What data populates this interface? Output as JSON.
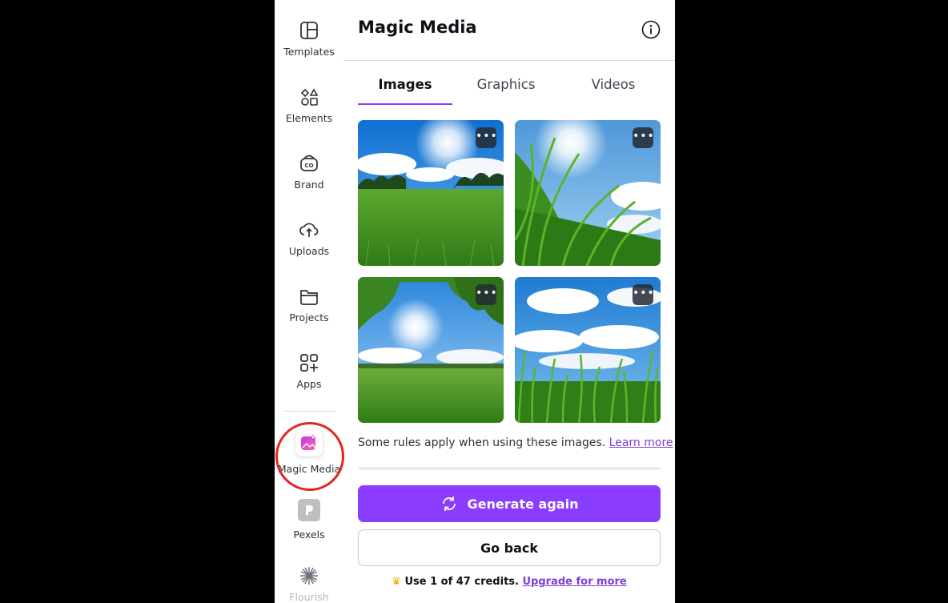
{
  "sidebar": {
    "items": [
      {
        "label": "Templates",
        "icon": "templates-icon"
      },
      {
        "label": "Elements",
        "icon": "elements-icon"
      },
      {
        "label": "Brand",
        "icon": "brand-icon"
      },
      {
        "label": "Uploads",
        "icon": "uploads-icon"
      },
      {
        "label": "Projects",
        "icon": "projects-icon"
      },
      {
        "label": "Apps",
        "icon": "apps-icon"
      },
      {
        "label": "Magic Media",
        "icon": "magic-media-icon",
        "selected": true
      },
      {
        "label": "Pexels",
        "icon": "pexels-icon"
      },
      {
        "label": "Flourish",
        "icon": "flourish-icon"
      }
    ]
  },
  "panel": {
    "title": "Magic Media",
    "tabs": [
      {
        "label": "Images",
        "active": true
      },
      {
        "label": "Graphics",
        "active": false
      },
      {
        "label": "Videos",
        "active": false
      }
    ],
    "results": [
      {
        "alt": "meadow-with-sun-image"
      },
      {
        "alt": "grass-closeup-image"
      },
      {
        "alt": "tree-canopy-field-image"
      },
      {
        "alt": "tall-grass-clouds-image"
      }
    ],
    "more_label": "•••",
    "rules_text": "Some rules apply when using these images.",
    "learn_more": "Learn more",
    "generate_label": "Generate again",
    "back_label": "Go back",
    "credits_text": "Use 1 of 47 credits.",
    "upgrade_label": "Upgrade for more"
  },
  "colors": {
    "accent": "#8b3dff",
    "link": "#7d3fd6",
    "highlight_ring": "#e0271f"
  }
}
